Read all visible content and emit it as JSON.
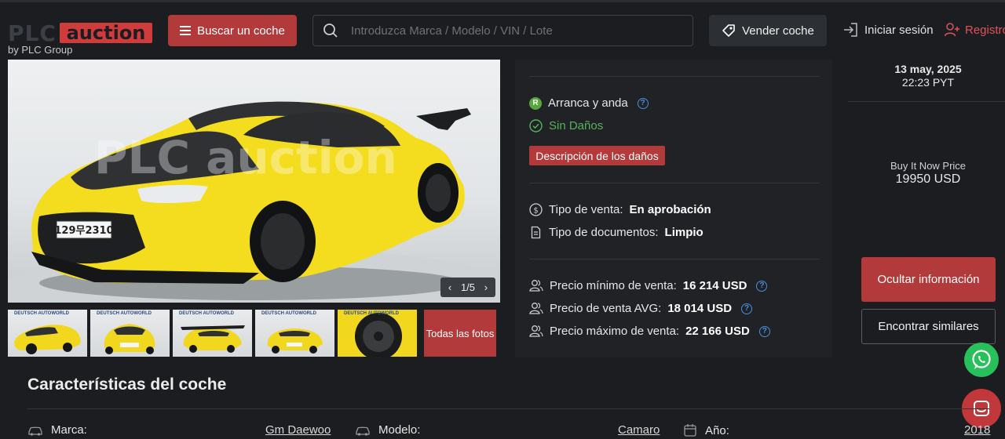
{
  "header": {
    "logo_plc": "PLC",
    "logo_auction": "auction",
    "logo_by": "by PLC Group",
    "buscar_label": "Buscar un coche",
    "search_placeholder": "Introduzca Marca / Modelo / VIN / Lote",
    "vender_label": "Vender coche",
    "login_label": "Iniciar sesión",
    "register_label": "Registro"
  },
  "gallery": {
    "counter_current": "1",
    "counter_sep": "/",
    "counter_total": "5",
    "thumb_brand": "DEUTSCH AUTOWORLD",
    "all_photos_label": "Todas las fotos",
    "main_plate": "129무2310",
    "watermark": "PLC auction"
  },
  "info": {
    "condition_badge": "R",
    "condition_label": "Arranca y anda",
    "damage_status": "Sin Daños",
    "damage_button": "Descripción de los daños",
    "sale_type_label": "Tipo de venta:",
    "sale_type_value": "En aprobación",
    "docs_label": "Tipo de documentos:",
    "docs_value": "Limpio",
    "price_min_label": "Precio mínimo de venta:",
    "price_min_value": "16 214 USD",
    "price_avg_label": "Precio de venta AVG:",
    "price_avg_value": "18 014 USD",
    "price_max_label": "Precio máximo de venta:",
    "price_max_value": "22 166 USD",
    "help_glyph": "?"
  },
  "sidebar": {
    "date": "13 may, 2025",
    "time": "22:23 PYT",
    "bin_label": "Buy It Now Price",
    "bin_value": "19950 USD",
    "hide_info": "Ocultar información",
    "find_similar": "Encontrar similares"
  },
  "characteristics": {
    "title": "Características del coche",
    "make_label": "Marca:",
    "make_value": "Gm Daewoo",
    "model_label": "Modelo:",
    "model_value": "Camaro",
    "year_label": "Año:",
    "year_value": "2018"
  },
  "colors": {
    "accent_red": "#b23a3a",
    "ok_green": "#57b35a",
    "help_blue": "#4a8fe0",
    "background": "#1b1d20"
  },
  "icons": [
    "menu-icon",
    "search-icon",
    "location-tag-icon",
    "login-icon",
    "user-add-icon",
    "check-circle-icon",
    "dollar-circle-icon",
    "document-icon",
    "users-icon",
    "whatsapp-icon",
    "chat-icon",
    "car-icon",
    "calendar-icon"
  ]
}
